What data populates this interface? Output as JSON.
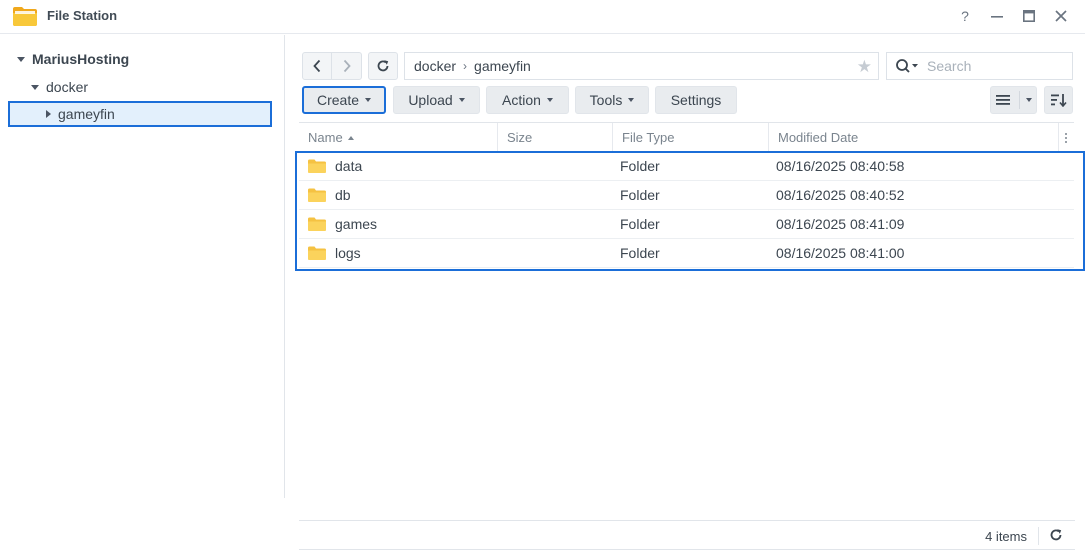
{
  "app": {
    "title": "File Station"
  },
  "window_controls": {
    "help": "?",
    "minimize": "—",
    "maximize": "□",
    "close": "✕"
  },
  "tree": {
    "root": "MariusHosting",
    "level1": "docker",
    "level2": "gameyfin"
  },
  "path": {
    "segments": [
      "docker",
      "gameyfin"
    ],
    "separator": "›"
  },
  "search": {
    "placeholder": "Search"
  },
  "toolbar": {
    "create": "Create",
    "upload": "Upload",
    "action": "Action",
    "tools": "Tools",
    "settings": "Settings"
  },
  "grid": {
    "columns": [
      "Name",
      "Size",
      "File Type",
      "Modified Date"
    ],
    "sort_column": "Name",
    "sort_direction": "ascending",
    "rows": [
      {
        "name": "data",
        "size": "",
        "type": "Folder",
        "modified": "08/16/2025 08:40:58"
      },
      {
        "name": "db",
        "size": "",
        "type": "Folder",
        "modified": "08/16/2025 08:40:52"
      },
      {
        "name": "games",
        "size": "",
        "type": "Folder",
        "modified": "08/16/2025 08:41:09"
      },
      {
        "name": "logs",
        "size": "",
        "type": "Folder",
        "modified": "08/16/2025 08:41:00"
      }
    ]
  },
  "footer": {
    "count": "4 items"
  },
  "colors": {
    "accent": "#1b6ed8",
    "selected_bg": "#e3f0fc",
    "folder": "#f5c242"
  },
  "icons": {
    "app": "file-station-folder-icon",
    "back": "chevron-left-icon",
    "forward": "chevron-right-icon",
    "refresh": "refresh-icon",
    "favorite": "star-icon",
    "search": "search-icon",
    "list_view": "list-view-icon",
    "sort": "sort-icon"
  }
}
